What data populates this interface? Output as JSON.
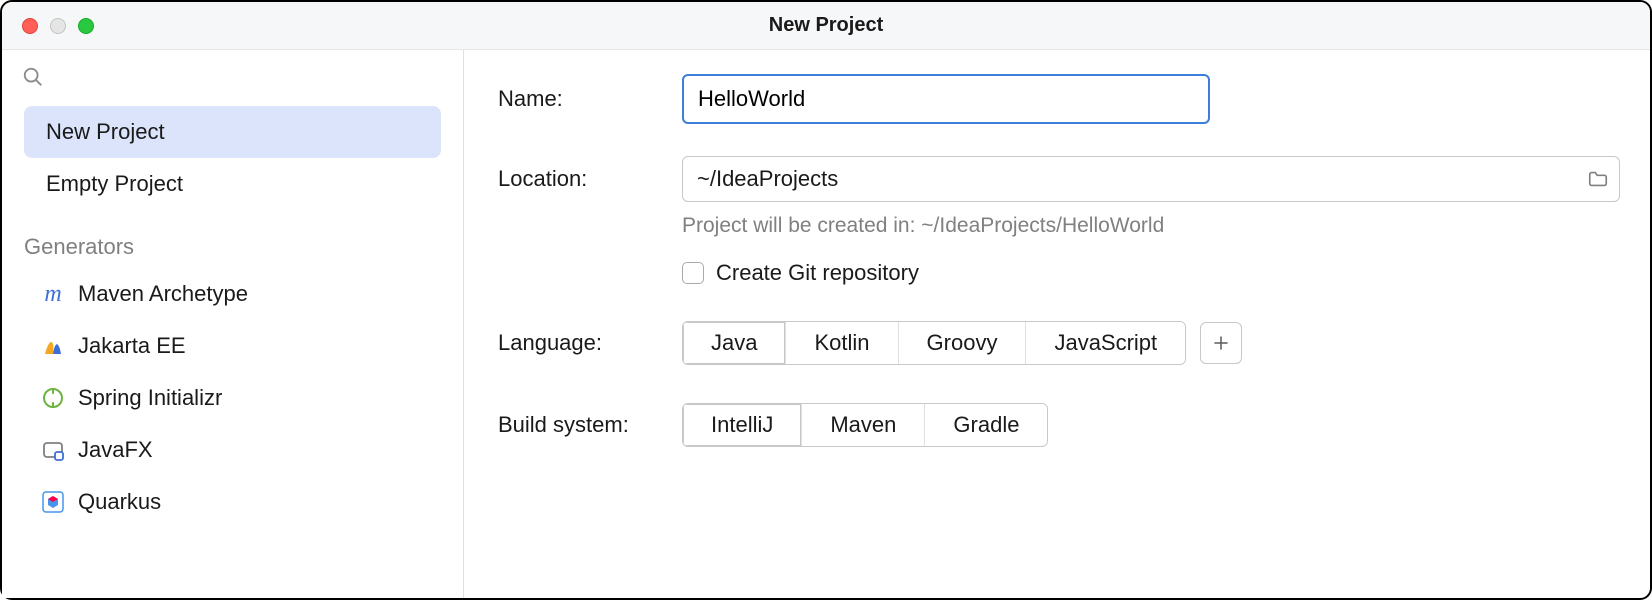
{
  "window": {
    "title": "New Project"
  },
  "sidebar": {
    "items": [
      {
        "label": "New Project",
        "selected": true
      },
      {
        "label": "Empty Project",
        "selected": false
      }
    ],
    "generators_header": "Generators",
    "generators": [
      {
        "label": "Maven Archetype",
        "icon": "maven"
      },
      {
        "label": "Jakarta EE",
        "icon": "jakarta"
      },
      {
        "label": "Spring Initializr",
        "icon": "spring"
      },
      {
        "label": "JavaFX",
        "icon": "javafx"
      },
      {
        "label": "Quarkus",
        "icon": "quarkus"
      }
    ]
  },
  "form": {
    "name_label": "Name:",
    "name_value": "HelloWorld",
    "location_label": "Location:",
    "location_value": "~/IdeaProjects",
    "hint": "Project will be created in: ~/IdeaProjects/HelloWorld",
    "git_label": "Create Git repository",
    "git_checked": false,
    "language_label": "Language:",
    "languages": [
      "Java",
      "Kotlin",
      "Groovy",
      "JavaScript"
    ],
    "language_selected": "Java",
    "build_label": "Build system:",
    "build_systems": [
      "IntelliJ",
      "Maven",
      "Gradle"
    ],
    "build_selected": "IntelliJ"
  }
}
